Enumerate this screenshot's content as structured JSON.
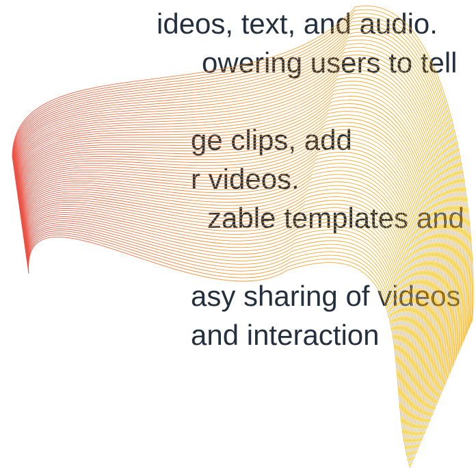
{
  "slide": {
    "lines": [
      "ideos, text, and audio.",
      "owering users to tell",
      "ge clips, add",
      "r videos.",
      "zable templates and",
      "asy sharing of videos",
      "and interaction"
    ]
  },
  "decoration": {
    "icon": "line-wave-graphic",
    "colors": {
      "red": "#e8483a",
      "orange": "#f08c27",
      "yellow": "#f2b41c",
      "text": "#24303e"
    }
  }
}
